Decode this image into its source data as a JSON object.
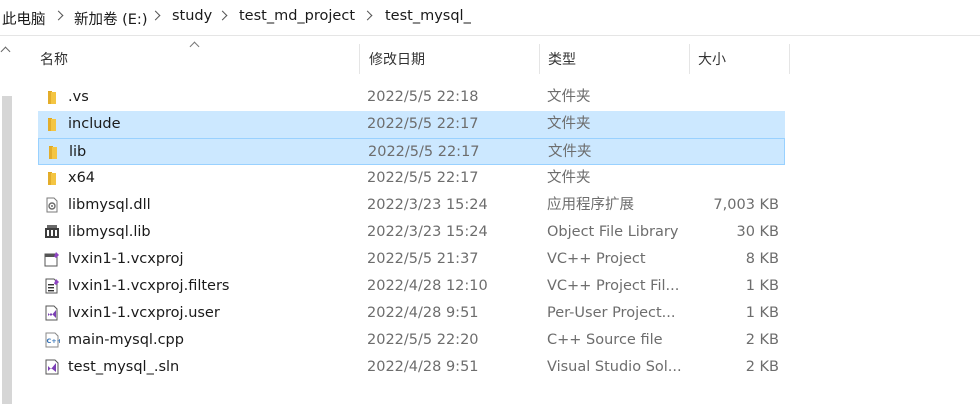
{
  "breadcrumb": {
    "items": [
      "此电脑",
      "新加卷 (E:)",
      "study",
      "test_md_project",
      "test_mysql_"
    ]
  },
  "columns": {
    "name": "名称",
    "date": "修改日期",
    "type": "类型",
    "size": "大小"
  },
  "colors": {
    "selection": "#cce8ff",
    "selection_border": "#99d1ff",
    "folder": "#f4c542"
  },
  "files": [
    {
      "name": ".vs",
      "date": "2022/5/5 22:18",
      "type": "文件夹",
      "size": "",
      "icon": "folder-icon"
    },
    {
      "name": "include",
      "date": "2022/5/5 22:17",
      "type": "文件夹",
      "size": "",
      "icon": "folder-icon",
      "selected": true
    },
    {
      "name": "lib",
      "date": "2022/5/5 22:17",
      "type": "文件夹",
      "size": "",
      "icon": "folder-icon",
      "selected": true
    },
    {
      "name": "x64",
      "date": "2022/5/5 22:17",
      "type": "文件夹",
      "size": "",
      "icon": "folder-icon"
    },
    {
      "name": "libmysql.dll",
      "date": "2022/3/23 15:24",
      "type": "应用程序扩展",
      "size": "7,003 KB",
      "icon": "dll-icon"
    },
    {
      "name": "libmysql.lib",
      "date": "2022/3/23 15:24",
      "type": "Object File Library",
      "size": "30 KB",
      "icon": "lib-file-icon"
    },
    {
      "name": "lvxin1-1.vcxproj",
      "date": "2022/5/5 21:37",
      "type": "VC++ Project",
      "size": "8 KB",
      "icon": "vcxproj-icon"
    },
    {
      "name": "lvxin1-1.vcxproj.filters",
      "date": "2022/4/28 12:10",
      "type": "VC++ Project Fil...",
      "size": "1 KB",
      "icon": "filters-icon"
    },
    {
      "name": "lvxin1-1.vcxproj.user",
      "date": "2022/4/28 9:51",
      "type": "Per-User Project...",
      "size": "1 KB",
      "icon": "vs-user-icon"
    },
    {
      "name": "main-mysql.cpp",
      "date": "2022/5/5 22:20",
      "type": "C++ Source file",
      "size": "2 KB",
      "icon": "cpp-icon"
    },
    {
      "name": "test_mysql_.sln",
      "date": "2022/4/28 9:51",
      "type": "Visual Studio Sol...",
      "size": "2 KB",
      "icon": "sln-icon"
    }
  ]
}
